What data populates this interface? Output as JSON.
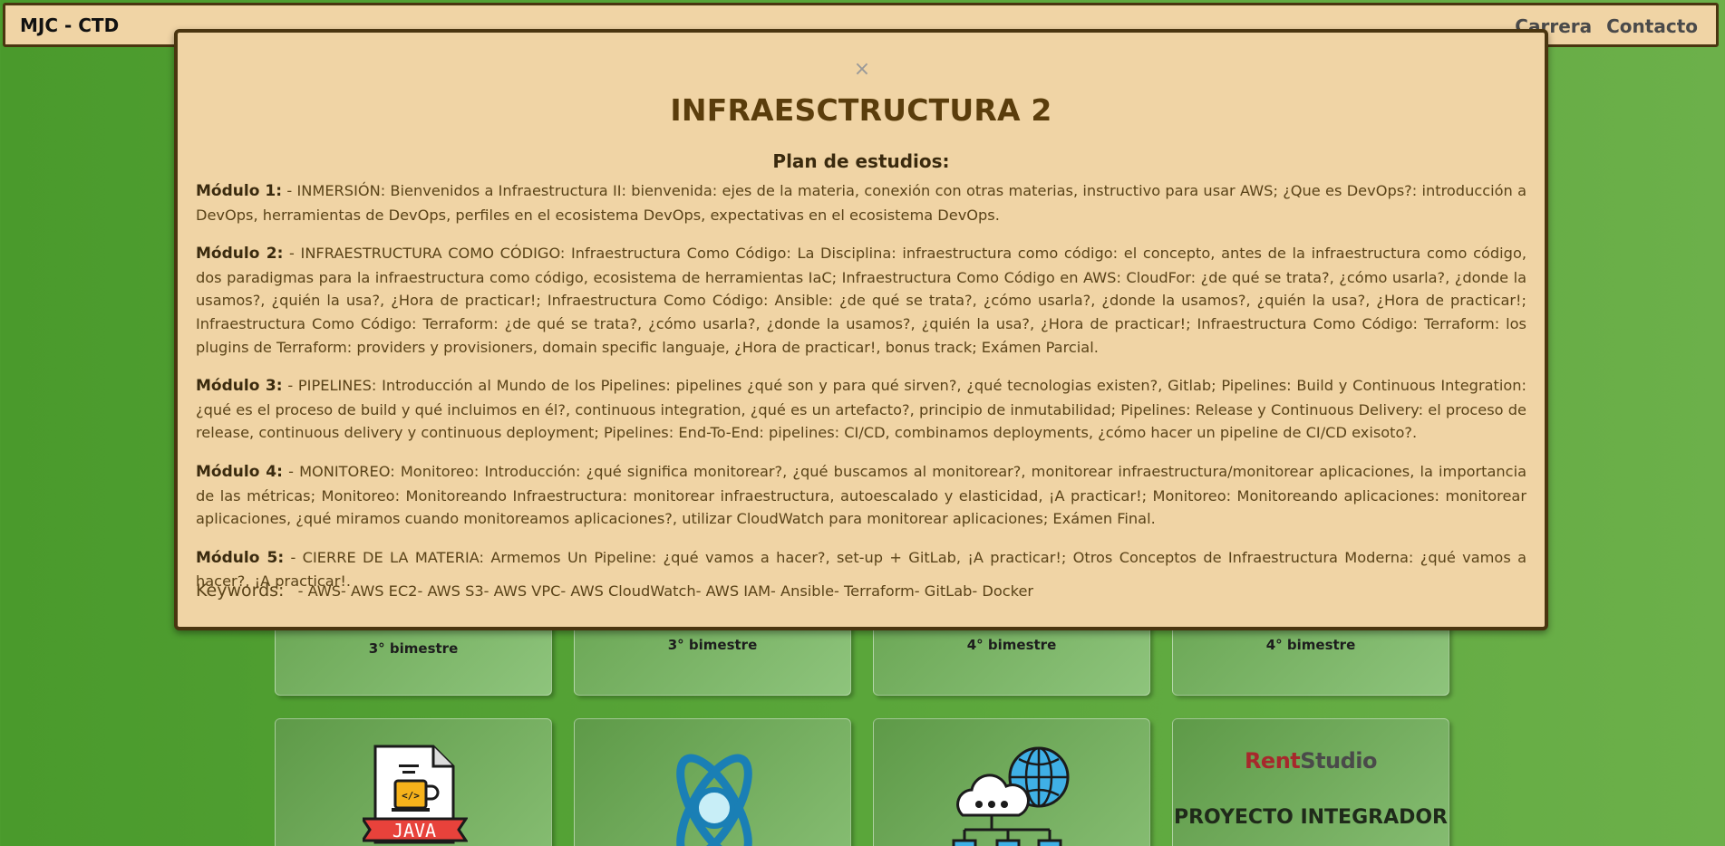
{
  "navbar": {
    "brand": "MJC - CTD",
    "links": [
      "Carrera",
      "Contacto"
    ]
  },
  "cards_top": [
    {
      "term": "3° bimestre"
    },
    {
      "term": "3° bimestre"
    },
    {
      "term": "4° bimestre"
    },
    {
      "term": "4° bimestre"
    }
  ],
  "cards_bottom": [
    {
      "icon": "java-icon",
      "label": "JAVA"
    },
    {
      "icon": "react-atom-icon"
    },
    {
      "icon": "cloud-network-icon"
    },
    {
      "logo_rent": "Rent",
      "logo_studio": "Studio",
      "title": "PROYECTO INTEGRADOR"
    }
  ],
  "modal": {
    "close": "×",
    "title": "INFRAESCTRUCTURA 2",
    "plan_heading": "Plan de estudios:",
    "modules": [
      {
        "label": "Módulo 1:",
        "text": " - INMERSIÓN: Bienvenidos a Infraestructura II: bienvenida: ejes de la materia, conexión con otras materias, instructivo para usar AWS; ¿Que es DevOps?: introducción a DevOps, herramientas de DevOps, perfiles en el ecosistema DevOps, expectativas en el ecosistema DevOps."
      },
      {
        "label": "Módulo 2:",
        "text": " - INFRAESTRUCTURA COMO CÓDIGO: Infraestructura Como Código: La Disciplina: infraestructura como código: el concepto, antes de la infraestructura como código, dos paradigmas para la infraestructura como código, ecosistema de herramientas IaC; Infraestructura Como Código en AWS: CloudFor: ¿de qué se trata?, ¿cómo usarla?, ¿donde la usamos?, ¿quién la usa?, ¿Hora de practicar!; Infraestructura Como Código: Ansible: ¿de qué se trata?, ¿cómo usarla?, ¿donde la usamos?, ¿quién la usa?, ¿Hora de practicar!; Infraestructura Como Código: Terraform: ¿de qué se trata?, ¿cómo usarla?, ¿donde la usamos?, ¿quién la usa?, ¿Hora de practicar!; Infraestructura Como Código: Terraform: los plugins de Terraform: providers y provisioners, domain specific languaje, ¿Hora de practicar!, bonus track; Exámen Parcial."
      },
      {
        "label": "Módulo 3:",
        "text": " - PIPELINES: Introducción al Mundo de los Pipelines: pipelines ¿qué son y para qué sirven?, ¿qué tecnologias existen?, Gitlab; Pipelines: Build y Continuous Integration: ¿qué es el proceso de build y qué incluimos en él?, continuous integration, ¿qué es un artefacto?, principio de inmutabilidad; Pipelines: Release y Continuous Delivery: el proceso de release, continuous delivery y continuous deployment; Pipelines: End-To-End: pipelines: CI/CD, combinamos deployments, ¿cómo hacer un pipeline de CI/CD exisoto?."
      },
      {
        "label": "Módulo 4:",
        "text": " - MONITOREO: Monitoreo: Introducción: ¿qué significa monitorear?, ¿qué buscamos al monitorear?, monitorear infraestructura/monitorear aplicaciones, la importancia de las métricas; Monitoreo: Monitoreando Infraestructura: monitorear infraestructura, autoescalado y elasticidad, ¡A practicar!; Monitoreo: Monitoreando aplicaciones: monitorear aplicaciones, ¿qué miramos cuando monitoreamos aplicaciones?, utilizar CloudWatch para monitorear aplicaciones; Exámen Final."
      },
      {
        "label": "Módulo 5:",
        "text": " - CIERRE DE LA MATERIA: Armemos Un Pipeline: ¿qué vamos a hacer?, set-up + GitLab, ¡A practicar!; Otros Conceptos de Infraestructura Moderna: ¿qué vamos a hacer?, ¡A practicar!."
      }
    ],
    "keywords_label": "Keywords:",
    "keywords": " - AWS- AWS EC2- AWS S3- AWS VPC- AWS CloudWatch- AWS IAM- Ansible- Terraform- GitLab- Docker"
  }
}
